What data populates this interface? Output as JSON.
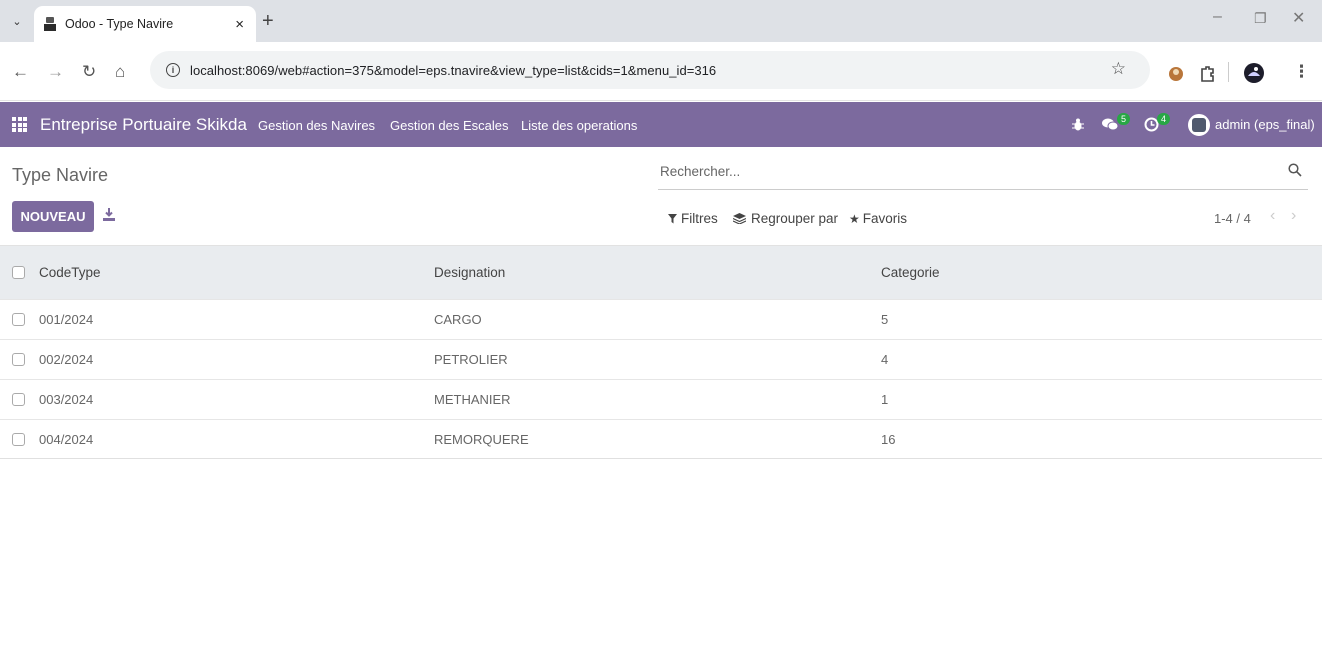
{
  "browser": {
    "tab_title": "Odoo - Type Navire",
    "tab_close": "×",
    "new_tab": "+",
    "url": "localhost:8069/web#action=375&model=eps.tnavire&view_type=list&cids=1&menu_id=316"
  },
  "navbar": {
    "brand": "Entreprise Portuaire Skikda",
    "menu": [
      "Gestion des Navires",
      "Gestion des Escales",
      "Liste des operations"
    ],
    "messages_count": "5",
    "activities_count": "4",
    "user": "admin (eps_final)"
  },
  "control_panel": {
    "breadcrumb": "Type Navire",
    "search_placeholder": "Rechercher...",
    "new_button": "NOUVEAU",
    "filters_label": "Filtres",
    "groupby_label": "Regrouper par",
    "favorites_label": "Favoris",
    "pager": "1-4 / 4"
  },
  "list": {
    "columns": [
      "CodeType",
      "Designation",
      "Categorie"
    ],
    "rows": [
      {
        "code": "001/2024",
        "designation": "CARGO",
        "categorie": "5"
      },
      {
        "code": "002/2024",
        "designation": "PETROLIER",
        "categorie": "4"
      },
      {
        "code": "003/2024",
        "designation": "METHANIER",
        "categorie": "1"
      },
      {
        "code": "004/2024",
        "designation": "REMORQUERE",
        "categorie": "16"
      }
    ]
  },
  "colors": {
    "odoo_primary": "#7c6a9e",
    "header_bg": "#e9ecef",
    "badge_green": "#28a745"
  }
}
